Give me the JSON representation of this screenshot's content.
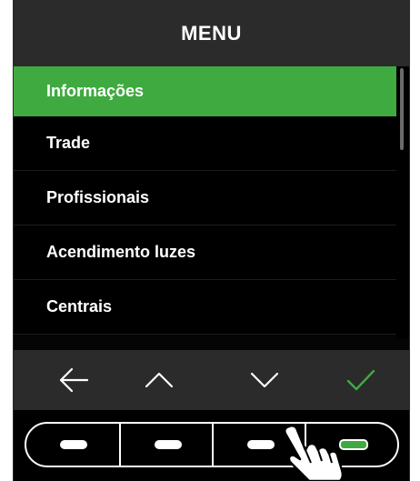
{
  "header": {
    "title": "MENU"
  },
  "menu": {
    "items": [
      {
        "label": "Informações",
        "selected": true
      },
      {
        "label": "Trade",
        "selected": false
      },
      {
        "label": "Profissionais",
        "selected": false
      },
      {
        "label": "Acendimento luzes",
        "selected": false
      },
      {
        "label": "Centrais",
        "selected": false
      }
    ]
  },
  "nav": {
    "buttons": [
      {
        "icon": "arrow-left-icon"
      },
      {
        "icon": "chevron-up-icon"
      },
      {
        "icon": "chevron-down-icon"
      },
      {
        "icon": "checkmark-icon"
      }
    ]
  },
  "hardware": {
    "keys": [
      {
        "indicator": "white"
      },
      {
        "indicator": "white"
      },
      {
        "indicator": "white"
      },
      {
        "indicator": "green"
      }
    ]
  },
  "colors": {
    "accent": "#3faa3f",
    "header_bg": "#2b2b2b",
    "list_bg": "#000000",
    "text": "#ffffff",
    "scrollbar": "#6a6a6a"
  }
}
